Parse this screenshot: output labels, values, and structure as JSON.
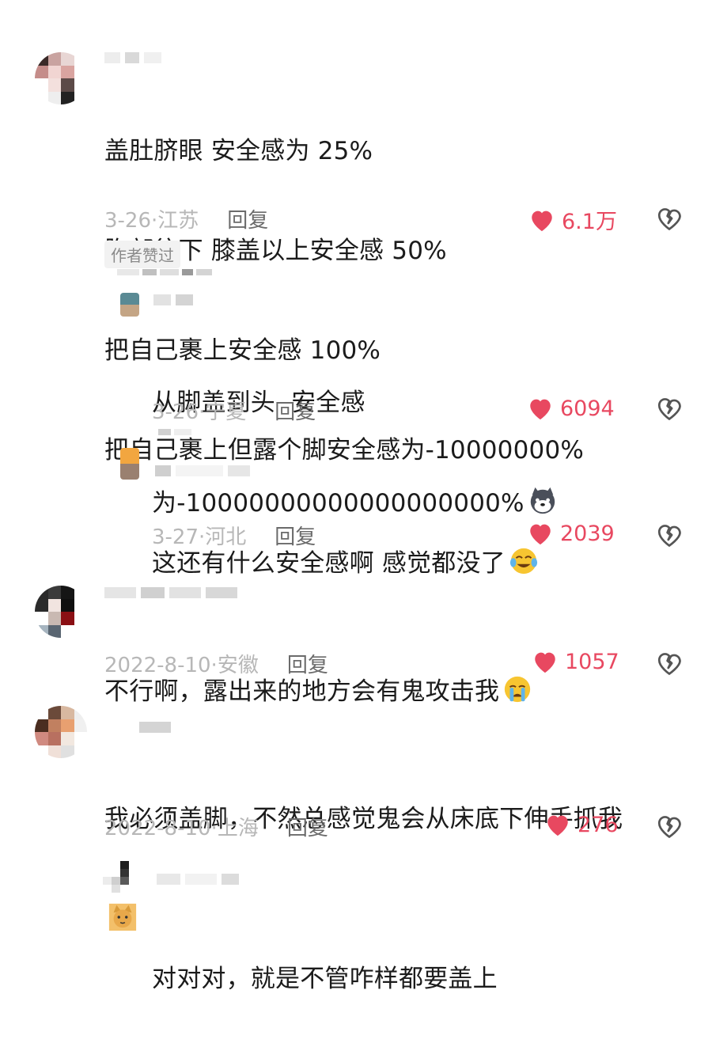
{
  "colors": {
    "like": "#e84860",
    "meta": "#b7b7b7",
    "reply": "#6b6b6b",
    "text": "#1b1b1b"
  },
  "comments": [
    {
      "lines": [
        "盖肚脐眼 安全感为 25%",
        "胸部往下 膝盖以上安全感 50%",
        "把自己裹上安全感 100%",
        "把自己裹上但露个脚安全感为-10000000%"
      ],
      "date": "3-26·江苏",
      "reply": "回复",
      "likes": "6.1万",
      "badge": "作者赞过"
    },
    {
      "lines": [
        "从脚盖到头  安全感",
        "为-10000000000000000000%"
      ],
      "emoji": "husky-face-emoji",
      "date": "3-26·宁夏",
      "reply": "回复",
      "likes": "6094"
    },
    {
      "lines": [
        "这还有什么安全感啊 感觉都没了"
      ],
      "emoji": "crying-laughing-emoji",
      "date": "3-27·河北",
      "reply": "回复",
      "likes": "2039"
    },
    {
      "lines": [
        "不行啊，露出来的地方会有鬼攻击我"
      ],
      "emoji": "crying-emoji",
      "date": "2022-8-10·安徽",
      "reply": "回复",
      "likes": "1057"
    },
    {
      "lines": [
        "我必须盖脚，不然总感觉鬼会从床底下伸手抓我"
      ],
      "emoji": "cat-emoji",
      "date": "2022-8-10·上海",
      "reply": "回复",
      "likes": "276"
    },
    {
      "lines": [
        "对对对，就是不管咋样都要盖上"
      ]
    }
  ]
}
